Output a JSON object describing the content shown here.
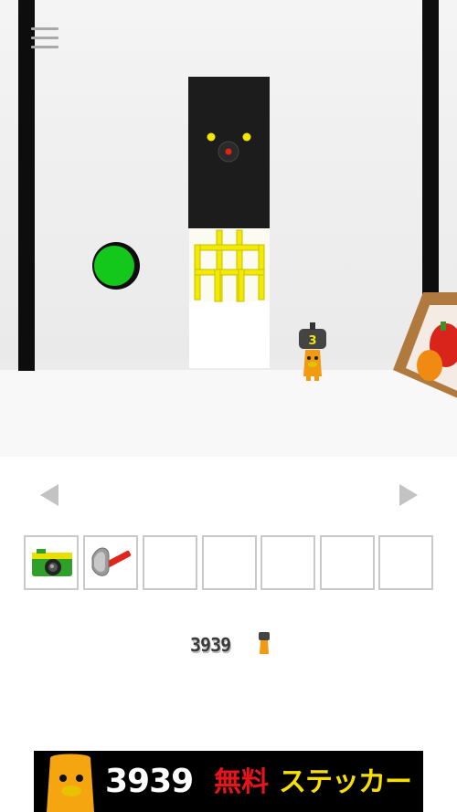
{
  "scene": {
    "wall_color": "#f0f0f0",
    "green_button_color": "#13c81b",
    "door_panel_color": "#1c1c1c",
    "eye_color": "#f3e600",
    "nose_color": "#e52313",
    "character_screen_digit": "3"
  },
  "inventory": {
    "slots": [
      {
        "item": "camera",
        "icon": "camera-icon"
      },
      {
        "item": "axe",
        "icon": "axe-icon"
      },
      {
        "item": "",
        "icon": ""
      },
      {
        "item": "",
        "icon": ""
      },
      {
        "item": "",
        "icon": ""
      },
      {
        "item": "",
        "icon": ""
      },
      {
        "item": "",
        "icon": ""
      }
    ]
  },
  "logo": {
    "text": "3939"
  },
  "banner": {
    "brand": "3939",
    "free_label": "無料",
    "sticker_label": "ステッカー",
    "colors": {
      "background": "#000000",
      "free": "#e8141c",
      "sticker": "#f7e000"
    }
  }
}
